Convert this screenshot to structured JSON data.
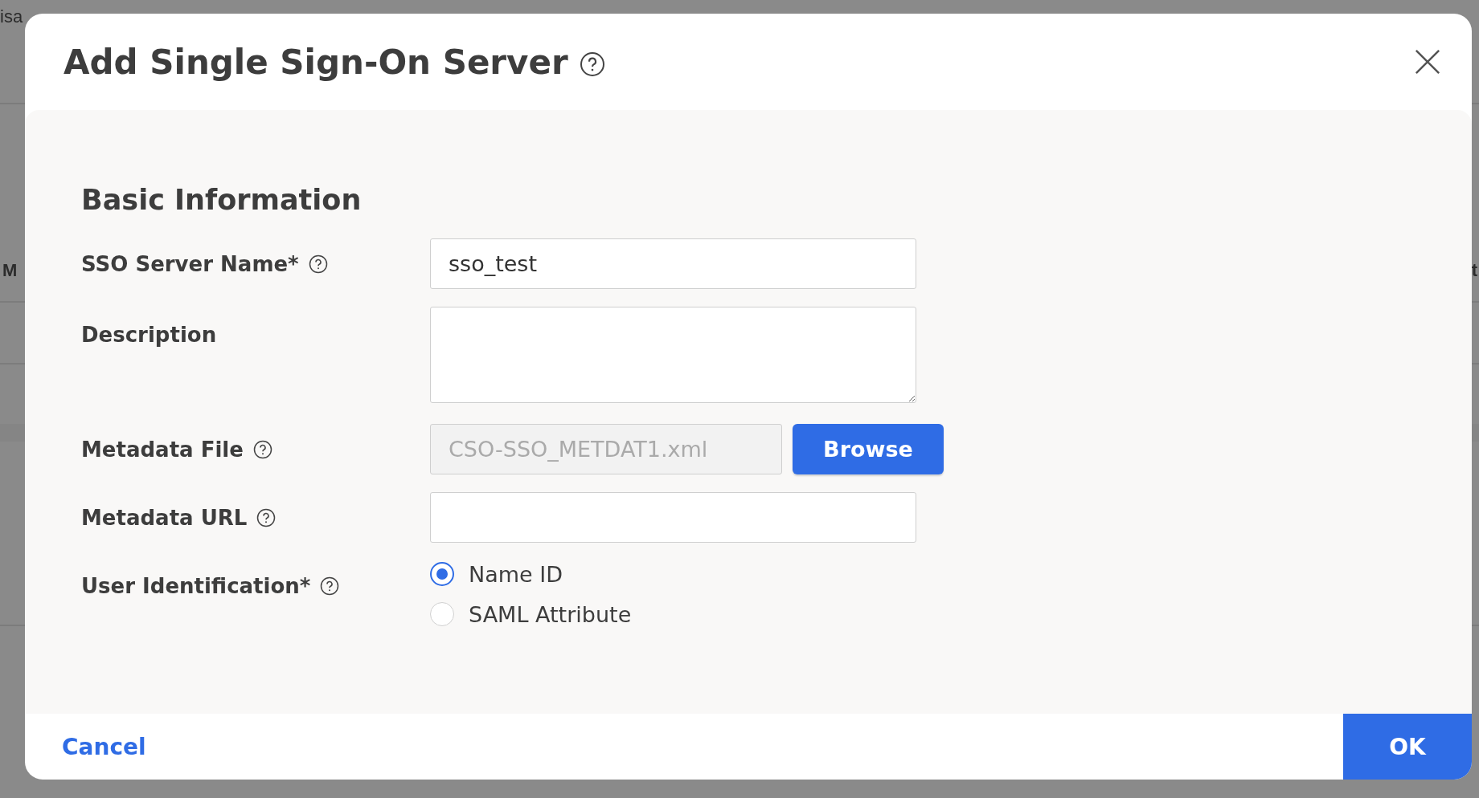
{
  "background": {
    "texts": [
      "isa",
      "M",
      "t"
    ]
  },
  "dialog": {
    "title": "Add Single Sign-On Server",
    "title_help": true,
    "section": "Basic Information",
    "fields": [
      {
        "kind": "text",
        "label": "SSO Server Name*",
        "help": true,
        "value": "sso_test"
      },
      {
        "kind": "textarea",
        "label": "Description",
        "help": false
      },
      {
        "kind": "file",
        "label": "Metadata File",
        "help": true,
        "value": "CSO-SSO_METDAT1.xml",
        "disabled": true,
        "button": "Browse"
      },
      {
        "kind": "text",
        "label": "Metadata URL",
        "help": true
      },
      {
        "kind": "radio",
        "label": "User Identification*",
        "help": true,
        "options": [
          {
            "label": "Name ID",
            "selected": true
          },
          {
            "label": "SAML Attribute",
            "selected": false
          }
        ]
      }
    ],
    "cancel": "Cancel",
    "ok": "OK"
  }
}
